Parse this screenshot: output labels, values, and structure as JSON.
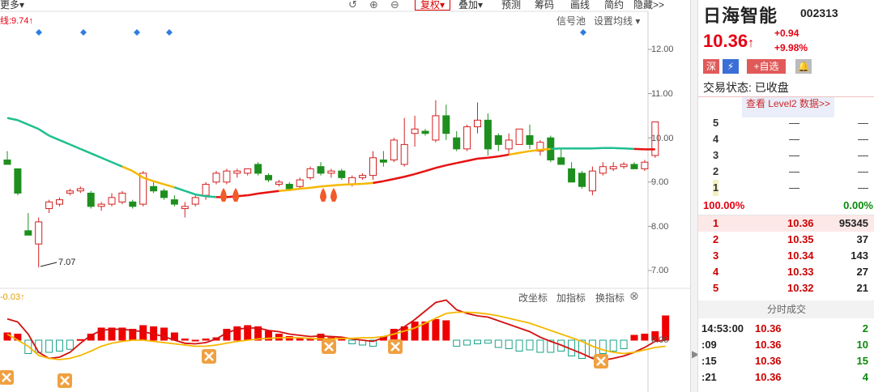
{
  "toolbar": {
    "more": "更多",
    "fuquan": "复权",
    "diejia": "叠加",
    "yuce": "预测",
    "choumа": "筹码",
    "huaxian": "画线",
    "jianyue": "简约",
    "yincang": "隐藏>>"
  },
  "kline": {
    "ma_label": "线:9.74↑",
    "signal_pool": "信号池",
    "set_ma": "设置均线",
    "low_label": "7.07",
    "y_ticks": [
      "12.00",
      "11.00",
      "10.00",
      "9.00",
      "8.00",
      "7.00"
    ],
    "y_values": [
      12,
      11,
      10,
      9,
      8,
      7
    ]
  },
  "indicator": {
    "label": "-0.03↑",
    "change_axis": "改坐标",
    "add_indicator": "加指标",
    "swap_indicator": "换指标",
    "zero": "0.00"
  },
  "chart_data": {
    "type": "candlestick",
    "y_range": [
      6.8,
      12.6
    ],
    "candles": [
      {
        "o": 9.5,
        "h": 9.7,
        "l": 9.4,
        "c": 9.4
      },
      {
        "o": 9.3,
        "h": 9.3,
        "l": 8.7,
        "c": 8.75
      },
      {
        "o": 7.9,
        "h": 8.3,
        "l": 7.8,
        "c": 7.8
      },
      {
        "o": 7.6,
        "h": 8.2,
        "l": 7.07,
        "c": 8.1
      },
      {
        "o": 8.4,
        "h": 8.6,
        "l": 8.3,
        "c": 8.55
      },
      {
        "o": 8.5,
        "h": 8.65,
        "l": 8.45,
        "c": 8.6
      },
      {
        "o": 8.75,
        "h": 8.85,
        "l": 8.7,
        "c": 8.8
      },
      {
        "o": 8.8,
        "h": 8.9,
        "l": 8.75,
        "c": 8.85
      },
      {
        "o": 8.75,
        "h": 8.8,
        "l": 8.4,
        "c": 8.45
      },
      {
        "o": 8.45,
        "h": 8.55,
        "l": 8.35,
        "c": 8.5
      },
      {
        "o": 8.5,
        "h": 8.75,
        "l": 8.45,
        "c": 8.65
      },
      {
        "o": 8.55,
        "h": 8.8,
        "l": 8.5,
        "c": 8.75
      },
      {
        "o": 8.55,
        "h": 8.6,
        "l": 8.4,
        "c": 8.45
      },
      {
        "o": 8.5,
        "h": 9.25,
        "l": 8.45,
        "c": 9.2
      },
      {
        "o": 8.9,
        "h": 9.0,
        "l": 8.75,
        "c": 8.8
      },
      {
        "o": 8.8,
        "h": 8.85,
        "l": 8.6,
        "c": 8.65
      },
      {
        "o": 8.6,
        "h": 8.7,
        "l": 8.45,
        "c": 8.5
      },
      {
        "o": 8.4,
        "h": 8.55,
        "l": 8.2,
        "c": 8.45
      },
      {
        "o": 8.5,
        "h": 8.7,
        "l": 8.45,
        "c": 8.65
      },
      {
        "o": 8.7,
        "h": 9.0,
        "l": 8.6,
        "c": 8.95
      },
      {
        "o": 9.0,
        "h": 9.25,
        "l": 8.95,
        "c": 9.2
      },
      {
        "o": 9.0,
        "h": 9.3,
        "l": 8.95,
        "c": 9.25
      },
      {
        "o": 9.2,
        "h": 9.3,
        "l": 9.1,
        "c": 9.25
      },
      {
        "o": 9.2,
        "h": 9.3,
        "l": 9.15,
        "c": 9.3
      },
      {
        "o": 9.4,
        "h": 9.45,
        "l": 9.15,
        "c": 9.2
      },
      {
        "o": 9.15,
        "h": 9.2,
        "l": 9.0,
        "c": 9.05
      },
      {
        "o": 8.95,
        "h": 9.05,
        "l": 8.9,
        "c": 9.0
      },
      {
        "o": 8.95,
        "h": 9.0,
        "l": 8.8,
        "c": 8.85
      },
      {
        "o": 8.9,
        "h": 9.1,
        "l": 8.85,
        "c": 9.05
      },
      {
        "o": 9.1,
        "h": 9.35,
        "l": 9.05,
        "c": 9.3
      },
      {
        "o": 9.35,
        "h": 9.45,
        "l": 9.15,
        "c": 9.2
      },
      {
        "o": 9.2,
        "h": 9.3,
        "l": 9.1,
        "c": 9.25
      },
      {
        "o": 9.25,
        "h": 9.3,
        "l": 9.05,
        "c": 9.1
      },
      {
        "o": 8.95,
        "h": 9.15,
        "l": 8.9,
        "c": 9.1
      },
      {
        "o": 9.1,
        "h": 9.2,
        "l": 9.05,
        "c": 9.15
      },
      {
        "o": 9.15,
        "h": 9.7,
        "l": 9.05,
        "c": 9.55
      },
      {
        "o": 9.5,
        "h": 9.7,
        "l": 9.35,
        "c": 9.45
      },
      {
        "o": 9.5,
        "h": 10.0,
        "l": 9.45,
        "c": 9.95
      },
      {
        "o": 9.4,
        "h": 10.45,
        "l": 9.35,
        "c": 9.85
      },
      {
        "o": 10.1,
        "h": 10.5,
        "l": 9.8,
        "c": 10.2
      },
      {
        "o": 10.15,
        "h": 10.2,
        "l": 10.05,
        "c": 10.1
      },
      {
        "o": 9.95,
        "h": 10.85,
        "l": 9.9,
        "c": 10.5
      },
      {
        "o": 10.5,
        "h": 10.75,
        "l": 9.95,
        "c": 10.1
      },
      {
        "o": 10.0,
        "h": 10.15,
        "l": 9.7,
        "c": 9.75
      },
      {
        "o": 9.75,
        "h": 10.3,
        "l": 9.7,
        "c": 10.25
      },
      {
        "o": 10.25,
        "h": 10.8,
        "l": 10.1,
        "c": 10.4
      },
      {
        "o": 10.4,
        "h": 10.55,
        "l": 9.6,
        "c": 9.75
      },
      {
        "o": 10.05,
        "h": 10.1,
        "l": 9.7,
        "c": 9.85
      },
      {
        "o": 9.75,
        "h": 10.1,
        "l": 9.6,
        "c": 9.95
      },
      {
        "o": 9.85,
        "h": 10.2,
        "l": 9.85,
        "c": 10.2
      },
      {
        "o": 10.05,
        "h": 10.3,
        "l": 9.75,
        "c": 9.85
      },
      {
        "o": 9.7,
        "h": 9.95,
        "l": 9.6,
        "c": 9.9
      },
      {
        "o": 10.0,
        "h": 10.05,
        "l": 9.45,
        "c": 9.5
      },
      {
        "o": 9.55,
        "h": 9.75,
        "l": 9.4,
        "c": 9.4
      },
      {
        "o": 9.3,
        "h": 9.45,
        "l": 9.0,
        "c": 9.0
      },
      {
        "o": 9.2,
        "h": 9.25,
        "l": 8.85,
        "c": 8.9
      },
      {
        "o": 8.8,
        "h": 9.35,
        "l": 8.7,
        "c": 9.25
      },
      {
        "o": 9.2,
        "h": 9.45,
        "l": 9.15,
        "c": 9.35
      },
      {
        "o": 9.3,
        "h": 9.45,
        "l": 9.25,
        "c": 9.35
      },
      {
        "o": 9.35,
        "h": 9.45,
        "l": 9.3,
        "c": 9.4
      },
      {
        "o": 9.4,
        "h": 9.45,
        "l": 9.3,
        "c": 9.3
      },
      {
        "o": 9.3,
        "h": 9.5,
        "l": 9.25,
        "c": 9.45
      },
      {
        "o": 9.6,
        "h": 10.36,
        "l": 9.55,
        "c": 10.36
      }
    ],
    "ma": [
      10.45,
      10.4,
      10.3,
      10.2,
      10.05,
      9.95,
      9.85,
      9.75,
      9.65,
      9.55,
      9.45,
      9.35,
      9.25,
      9.1,
      9.02,
      8.95,
      8.88,
      8.8,
      8.72,
      8.68,
      8.66,
      8.66,
      8.68,
      8.7,
      8.74,
      8.77,
      8.8,
      8.82,
      8.85,
      8.87,
      8.9,
      8.92,
      8.94,
      8.95,
      8.96,
      8.98,
      9.02,
      9.07,
      9.12,
      9.18,
      9.25,
      9.32,
      9.38,
      9.43,
      9.48,
      9.53,
      9.55,
      9.58,
      9.62,
      9.66,
      9.7,
      9.73,
      9.75,
      9.76,
      9.76,
      9.76,
      9.76,
      9.77,
      9.77,
      9.76,
      9.75,
      9.74,
      9.74
    ],
    "macd": [
      0.12,
      0.1,
      -0.22,
      -0.2,
      -0.2,
      -0.18,
      -0.15,
      0.01,
      0.1,
      0.2,
      0.2,
      0.2,
      0.18,
      0.24,
      0.22,
      0.2,
      0.12,
      0.02,
      0.0,
      0.02,
      0.04,
      0.18,
      0.22,
      0.24,
      0.22,
      0.15,
      0.1,
      0.06,
      0.03,
      0.02,
      0.1,
      0.04,
      0.04,
      -0.06,
      -0.08,
      -0.1,
      0.05,
      0.18,
      0.22,
      0.3,
      0.3,
      0.34,
      0.32,
      -0.1,
      -0.08,
      -0.06,
      -0.05,
      -0.12,
      -0.14,
      -0.18,
      -0.16,
      -0.2,
      -0.2,
      -0.18,
      -0.26,
      -0.3,
      -0.28,
      -0.22,
      -0.18,
      -0.14,
      0.08,
      0.1,
      0.14,
      0.4
    ],
    "dif": [
      0.35,
      0.3,
      0.1,
      -0.2,
      -0.3,
      -0.28,
      -0.2,
      -0.05,
      0.08,
      0.16,
      0.18,
      0.18,
      0.16,
      0.14,
      0.1,
      0.06,
      0.0,
      -0.05,
      -0.06,
      -0.04,
      0.02,
      0.12,
      0.18,
      0.2,
      0.2,
      0.16,
      0.14,
      0.1,
      0.08,
      0.06,
      0.07,
      0.06,
      0.05,
      0.02,
      0.0,
      -0.02,
      0.04,
      0.12,
      0.22,
      0.34,
      0.48,
      0.62,
      0.66,
      0.5,
      0.44,
      0.4,
      0.38,
      0.32,
      0.26,
      0.2,
      0.14,
      0.05,
      -0.02,
      -0.08,
      -0.15,
      -0.22,
      -0.3,
      -0.33,
      -0.3,
      -0.26,
      -0.2,
      -0.12,
      -0.02,
      0.0
    ],
    "dea": [
      0.1,
      0.0,
      -0.1,
      -0.25,
      -0.3,
      -0.32,
      -0.3,
      -0.25,
      -0.18,
      -0.1,
      -0.05,
      -0.02,
      0.0,
      0.0,
      -0.02,
      -0.04,
      -0.06,
      -0.08,
      -0.1,
      -0.1,
      -0.08,
      -0.05,
      -0.02,
      0.0,
      0.02,
      0.03,
      0.04,
      0.04,
      0.04,
      0.03,
      0.02,
      0.02,
      0.03,
      0.03,
      0.04,
      0.04,
      0.06,
      0.1,
      0.15,
      0.2,
      0.28,
      0.36,
      0.44,
      0.46,
      0.46,
      0.45,
      0.43,
      0.4,
      0.36,
      0.32,
      0.28,
      0.22,
      0.16,
      0.1,
      0.04,
      -0.02,
      -0.1,
      -0.16,
      -0.2,
      -0.22,
      -0.2,
      -0.16,
      -0.12,
      -0.1
    ]
  },
  "side": {
    "name": "日海智能",
    "code": "002313",
    "price": "10.36",
    "arrow": "↑",
    "change": "+0.94",
    "change_pct": "+9.98%",
    "badge_shen": "深",
    "badge_add": "+自选",
    "status": "交易状态: 已收盘",
    "level2": "查看 Level2 数据>>",
    "sell": [
      {
        "n": "5",
        "p": "—",
        "v": "—"
      },
      {
        "n": "4",
        "p": "—",
        "v": "—"
      },
      {
        "n": "3",
        "p": "—",
        "v": "—"
      },
      {
        "n": "2",
        "p": "—",
        "v": "—"
      },
      {
        "n": "1",
        "p": "—",
        "v": "—"
      }
    ],
    "ratio_left": "100.00%",
    "ratio_right": "0.00%",
    "buy": [
      {
        "n": "1",
        "p": "10.36",
        "v": "95345"
      },
      {
        "n": "2",
        "p": "10.35",
        "v": "37"
      },
      {
        "n": "3",
        "p": "10.34",
        "v": "143"
      },
      {
        "n": "4",
        "p": "10.33",
        "v": "27"
      },
      {
        "n": "5",
        "p": "10.32",
        "v": "21"
      }
    ],
    "ticks_title": "分时成交",
    "ticks": [
      {
        "t": "14:53:00",
        "p": "10.36",
        "v": "2"
      },
      {
        "t": ":09",
        "p": "10.36",
        "v": "10"
      },
      {
        "t": ":15",
        "p": "10.36",
        "v": "15"
      },
      {
        "t": ":21",
        "p": "10.36",
        "v": "4"
      }
    ]
  }
}
